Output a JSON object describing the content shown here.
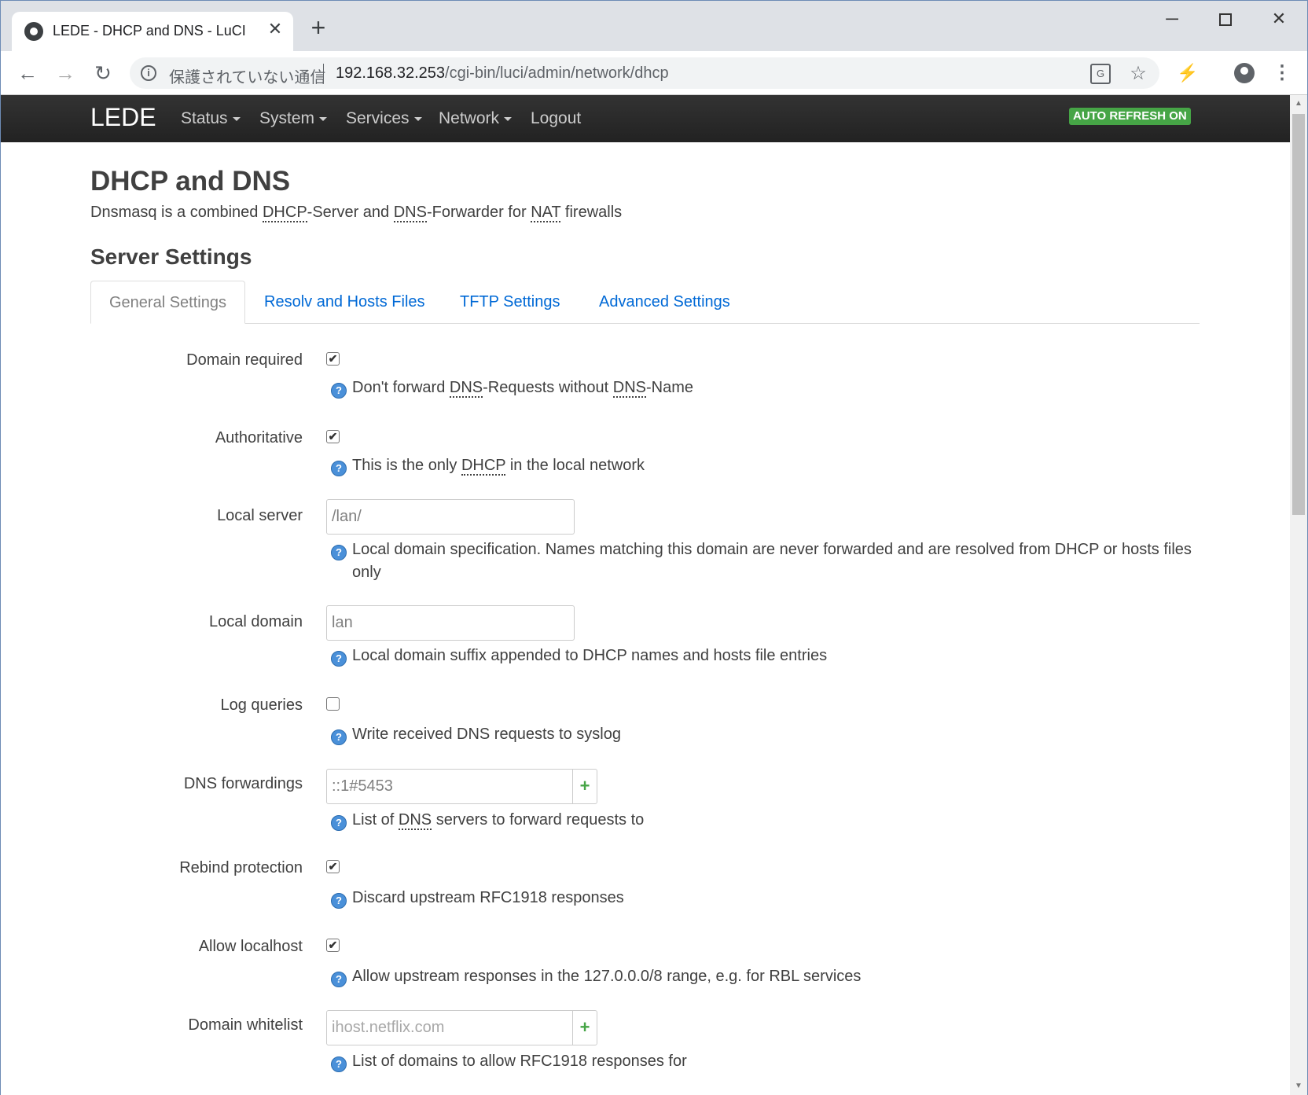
{
  "browser": {
    "tab_title": "LEDE - DHCP and DNS - LuCI",
    "secure_label": "保護されていない通信",
    "url_host": "192.168.32.253",
    "url_path": "/cgi-bin/luci/admin/network/dhcp"
  },
  "header": {
    "brand": "LEDE",
    "nav": [
      "Status",
      "System",
      "Services",
      "Network",
      "Logout"
    ],
    "auto_refresh": "AUTO REFRESH ON",
    "auto_refresh_color": "#46a546"
  },
  "page": {
    "title": "DHCP and DNS",
    "desc_1": "Dnsmasq is a combined ",
    "desc_dhcp": "DHCP",
    "desc_2": "-Server and ",
    "desc_dns": "DNS",
    "desc_3": "-Forwarder for ",
    "desc_nat": "NAT",
    "desc_4": " firewalls",
    "section_title": "Server Settings"
  },
  "tabs": [
    "General Settings",
    "Resolv and Hosts Files",
    "TFTP Settings",
    "Advanced Settings"
  ],
  "fields": {
    "domain_required": {
      "label": "Domain required",
      "checked": true,
      "help_1": "Don't forward ",
      "help_abbr": "DNS",
      "help_2": "-Requests without ",
      "help_abbr2": "DNS",
      "help_3": "-Name"
    },
    "authoritative": {
      "label": "Authoritative",
      "checked": true,
      "help_1": "This is the only ",
      "help_abbr": "DHCP",
      "help_2": " in the local network"
    },
    "local_server": {
      "label": "Local server",
      "value": "/lan/",
      "help_1": "Local domain specification. Names matching this domain are never forwarded and are resolved from DHCP or hosts files",
      "help_2": "only"
    },
    "local_domain": {
      "label": "Local domain",
      "value": "lan",
      "help": "Local domain suffix appended to DHCP names and hosts file entries"
    },
    "log_queries": {
      "label": "Log queries",
      "checked": false,
      "help": "Write received DNS requests to syslog"
    },
    "dns_forwardings": {
      "label": "DNS forwardings",
      "value": "::1#5453",
      "help_1": "List of ",
      "help_abbr": "DNS",
      "help_2": " servers to forward requests to"
    },
    "rebind_protection": {
      "label": "Rebind protection",
      "checked": true,
      "help": "Discard upstream RFC1918 responses"
    },
    "allow_localhost": {
      "label": "Allow localhost",
      "checked": true,
      "help": "Allow upstream responses in the 127.0.0.0/8 range, e.g. for RBL services"
    },
    "domain_whitelist": {
      "label": "Domain whitelist",
      "placeholder": "ihost.netflix.com",
      "help": "List of domains to allow RFC1918 responses for"
    }
  },
  "icons": {
    "check": "✔",
    "add": "+",
    "help": "?"
  }
}
